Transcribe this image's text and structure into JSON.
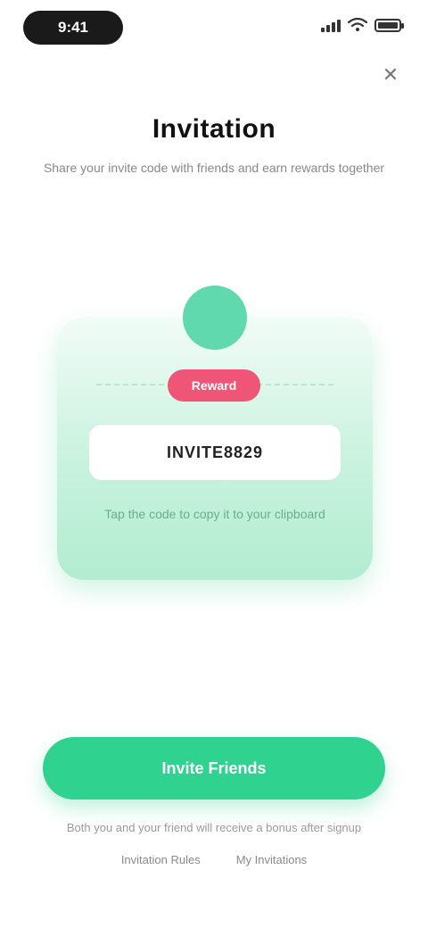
{
  "status_bar": {
    "time": "9:41"
  },
  "header": {
    "title": "Invitation",
    "subtitle": "Share your invite code with friends and earn rewards together"
  },
  "close_label": "✕",
  "card": {
    "tag": "Reward",
    "code": "INVITE8829",
    "note": "Tap the code to copy it to your clipboard"
  },
  "primary_button_label": "Invite Friends",
  "footer": {
    "note": "Both you and your friend will receive a bonus after signup",
    "link_rules": "Invitation Rules",
    "link_records": "My Invitations"
  },
  "colors": {
    "accent": "#2fd28e",
    "tag": "#ee5577",
    "avatar": "#5fd9ad"
  },
  "icons": [
    "signal-icon",
    "wifi-icon",
    "battery-icon",
    "close-icon"
  ]
}
